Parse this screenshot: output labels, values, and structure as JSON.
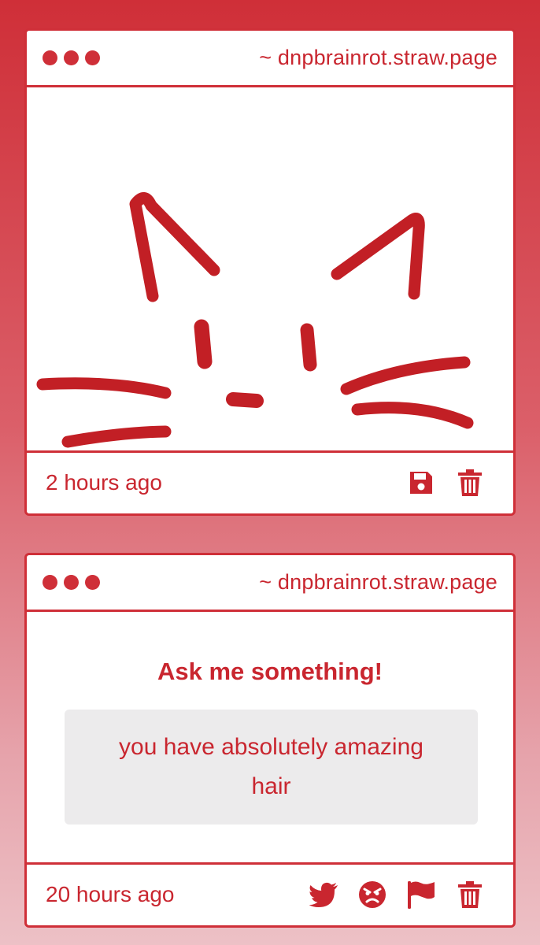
{
  "cards": [
    {
      "url": "~ dnpbrainrot.straw.page",
      "content_type": "drawing",
      "time": "2 hours ago",
      "actions": [
        "save-icon",
        "trash-icon"
      ]
    },
    {
      "url": "~ dnpbrainrot.straw.page",
      "content_type": "question",
      "prompt": "Ask me something!",
      "answer": "you have absolutely amazing hair",
      "time": "20 hours ago",
      "actions": [
        "twitter-icon",
        "angry-face-icon",
        "flag-icon",
        "trash-icon"
      ]
    }
  ],
  "colors": {
    "accent": "#cf2f38",
    "answer_bg": "#ecebec"
  }
}
